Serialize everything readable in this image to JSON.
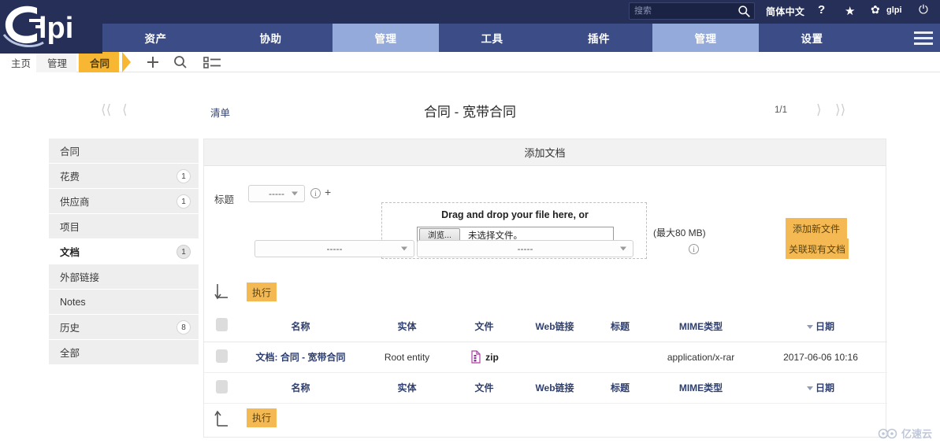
{
  "header": {
    "logo_text": "glpi",
    "search": {
      "placeholder": "搜索",
      "value": ""
    },
    "language": "简体中文",
    "help_glyph": "?",
    "star_glyph": "★",
    "gear_glyph": "✿",
    "user": "glpi",
    "power_glyph": "⏻"
  },
  "nav": {
    "items": [
      {
        "label": "资产",
        "active": false
      },
      {
        "label": "协助",
        "active": false
      },
      {
        "label": "管理",
        "active": true
      },
      {
        "label": "工具",
        "active": false
      },
      {
        "label": "插件",
        "active": false
      },
      {
        "label": "管理",
        "active": true
      },
      {
        "label": "设置",
        "active": false
      }
    ]
  },
  "breadcrumb": {
    "items": [
      "主页",
      "管理",
      "合同"
    ],
    "icons": [
      "plus-icon",
      "search-icon",
      "list-icon"
    ]
  },
  "titlebar": {
    "list_link": "清单",
    "title": "合同 - 宽带合同",
    "page_count": "1/1"
  },
  "sidebar": {
    "items": [
      {
        "label": "合同",
        "badge": "",
        "active": false
      },
      {
        "label": "花费",
        "badge": "1",
        "active": false
      },
      {
        "label": "供应商",
        "badge": "1",
        "active": false
      },
      {
        "label": "项目",
        "badge": "",
        "active": false
      },
      {
        "label": "文档",
        "badge": "1",
        "active": true
      },
      {
        "label": "外部链接",
        "badge": "",
        "active": false
      },
      {
        "label": "Notes",
        "badge": "",
        "active": false
      },
      {
        "label": "历史",
        "badge": "8",
        "active": false
      },
      {
        "label": "全部",
        "badge": "",
        "active": false
      }
    ]
  },
  "panel": {
    "heading": "添加文档",
    "title_label": "标题",
    "title_select": "-----",
    "plus_label": "+",
    "dropzone_text": "Drag and drop your file here, or",
    "browse_button": "浏览...",
    "no_file_text": "未选择文件。",
    "max_size": "(最大80 MB)",
    "add_new_file_button": "添加新文件",
    "select_a": "-----",
    "select_b": "-----",
    "link_existing_button": "关联现有文档",
    "execute_top": "执行",
    "execute_bottom": "执行"
  },
  "table": {
    "columns": [
      "名称",
      "实体",
      "文件",
      "Web链接",
      "标题",
      "MIME类型",
      "日期"
    ],
    "sorted_column": "日期",
    "rows": [
      {
        "name": "文档: 合同 - 宽带合同",
        "entity": "Root entity",
        "file": "zip",
        "weblink": "",
        "title": "",
        "mime": "application/x-rar",
        "date": "2017-06-06 10:16"
      }
    ]
  },
  "watermark": {
    "text": "亿速云"
  },
  "colors": {
    "topbar": "#262f58",
    "nav": "#3b4c86",
    "nav_active": "#93aada",
    "accent_orange": "#f4b953",
    "crumb_active": "#f7b733",
    "link_blue": "#2e3f70"
  }
}
